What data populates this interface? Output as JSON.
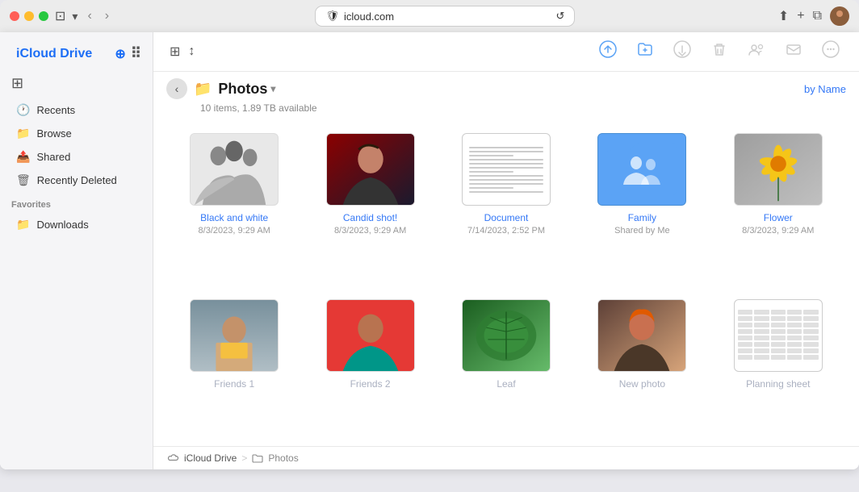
{
  "browser": {
    "url": "icloud.com",
    "tab_label": "iCloud Drive",
    "shield_icon": "🛡",
    "refresh_icon": "↺",
    "back_icon": "‹",
    "forward_icon": "›"
  },
  "sidebar": {
    "brand": "iCloud Drive",
    "brand_apple": "",
    "toggle_icon": "⊞",
    "nav_items": [
      {
        "id": "recents",
        "label": "Recents",
        "icon": "🕐"
      },
      {
        "id": "browse",
        "label": "Browse",
        "icon": "📁"
      },
      {
        "id": "shared",
        "label": "Shared",
        "icon": "📤"
      },
      {
        "id": "recently-deleted",
        "label": "Recently Deleted",
        "icon": "🗑"
      }
    ],
    "favorites_label": "Favorites",
    "favorites_items": [
      {
        "id": "downloads",
        "label": "Downloads",
        "icon": "📁"
      }
    ]
  },
  "toolbar": {
    "view_grid_icon": "⊞",
    "view_sort_icon": "↕",
    "upload_icon": "↑",
    "new_folder_icon": "📁",
    "cloud_down_icon": "⬇",
    "trash_icon": "🗑",
    "share_icon": "👥",
    "mail_icon": "✉",
    "more_icon": "•••",
    "sort_label": "by Name"
  },
  "content": {
    "back_icon": "‹",
    "folder_icon": "📁",
    "folder_name": "Photos",
    "dropdown_icon": "▾",
    "items_count": "10 items, 1.89 TB available",
    "files": [
      {
        "id": "black-and-white",
        "name": "Black and white",
        "meta": "8/3/2023, 9:29 AM",
        "type": "photo-bw"
      },
      {
        "id": "candid-shot",
        "name": "Candid shot!",
        "meta": "8/3/2023, 9:29 AM",
        "type": "photo-candid"
      },
      {
        "id": "document",
        "name": "Document",
        "meta": "7/14/2023, 2:52 PM",
        "type": "document"
      },
      {
        "id": "family",
        "name": "Family",
        "meta": "Shared by Me",
        "type": "folder-shared"
      },
      {
        "id": "flower",
        "name": "Flower",
        "meta": "8/3/2023, 9:29 AM",
        "type": "photo-flower"
      },
      {
        "id": "friends1",
        "name": "Friends 1",
        "meta": "",
        "type": "photo-friends1",
        "grayed": true
      },
      {
        "id": "friends2",
        "name": "Friends 2",
        "meta": "",
        "type": "photo-friends2",
        "grayed": true
      },
      {
        "id": "leaf",
        "name": "Leaf",
        "meta": "",
        "type": "photo-leaf",
        "grayed": true
      },
      {
        "id": "new-photo",
        "name": "New photo",
        "meta": "",
        "type": "photo-newphoto",
        "grayed": true
      },
      {
        "id": "planning-sheet",
        "name": "Planning sheet",
        "meta": "",
        "type": "spreadsheet",
        "grayed": true
      }
    ]
  },
  "breadcrumb": {
    "cloud_label": "iCloud Drive",
    "sep": ">",
    "current": "Photos"
  }
}
